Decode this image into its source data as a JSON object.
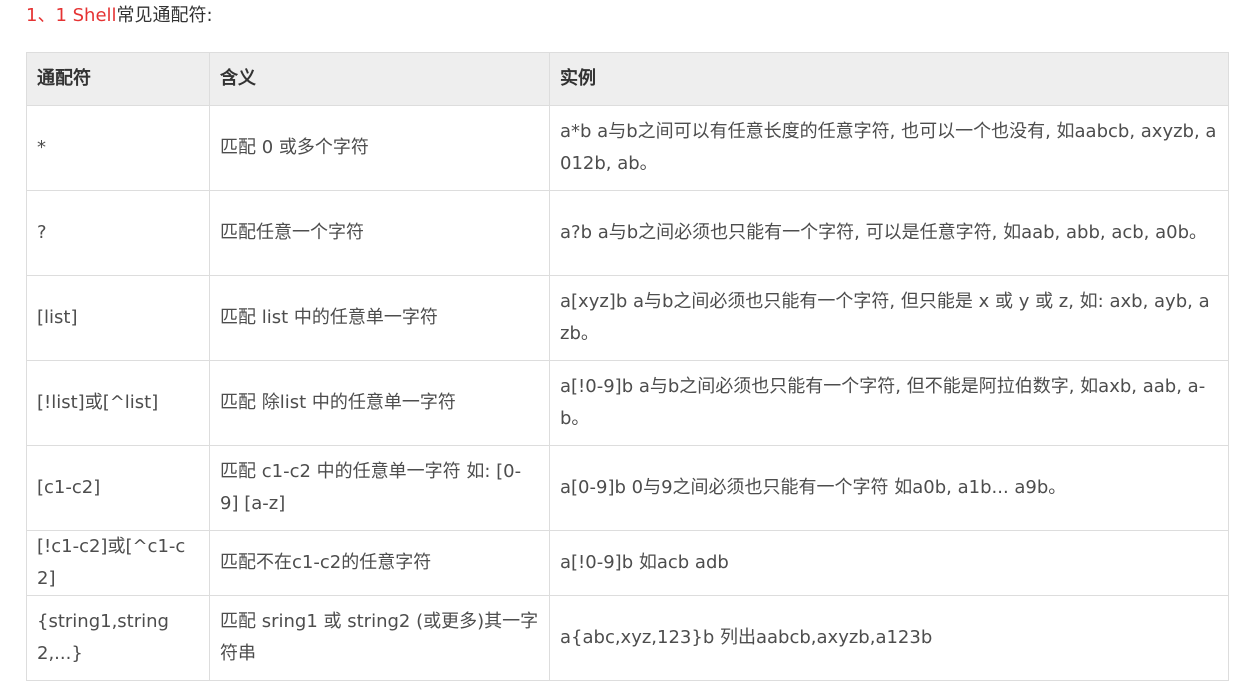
{
  "heading": {
    "number": "1、1 Shell",
    "text": "常见通配符:"
  },
  "table": {
    "headers": [
      "通配符",
      "含义",
      "实例"
    ],
    "rows": [
      {
        "wildcard": "*",
        "meaning": "匹配 0 或多个字符",
        "example": "a*b a与b之间可以有任意长度的任意字符, 也可以一个也没有, 如aabcb, axyzb, a012b, ab。"
      },
      {
        "wildcard": "?",
        "meaning": "匹配任意一个字符",
        "example": "a?b a与b之间必须也只能有一个字符, 可以是任意字符, 如aab, abb, acb, a0b。"
      },
      {
        "wildcard": "[list]",
        "meaning": "匹配 list 中的任意单一字符",
        "example": "a[xyz]b  a与b之间必须也只能有一个字符, 但只能是 x 或 y 或 z, 如: axb, ayb, azb。"
      },
      {
        "wildcard": "[!list]或[^list]",
        "meaning": "匹配 除list 中的任意单一字符",
        "example": "a[!0-9]b a与b之间必须也只能有一个字符, 但不能是阿拉伯数字, 如axb, aab, a-b。"
      },
      {
        "wildcard": "[c1-c2]",
        "meaning": "匹配 c1-c2 中的任意单一字符 如: [0-9] [a-z]",
        "example": "a[0-9]b 0与9之间必须也只能有一个字符 如a0b, a1b... a9b。"
      },
      {
        "wildcard": "[!c1-c2]或[^c1-c2]",
        "meaning": "匹配不在c1-c2的任意字符",
        "example": "a[!0-9]b 如acb adb"
      },
      {
        "wildcard": "{string1,string2,...}",
        "meaning": "匹配 sring1 或 string2 (或更多)其一字符串",
        "example": "a{abc,xyz,123}b 列出aabcb,axyzb,a123b"
      }
    ]
  }
}
